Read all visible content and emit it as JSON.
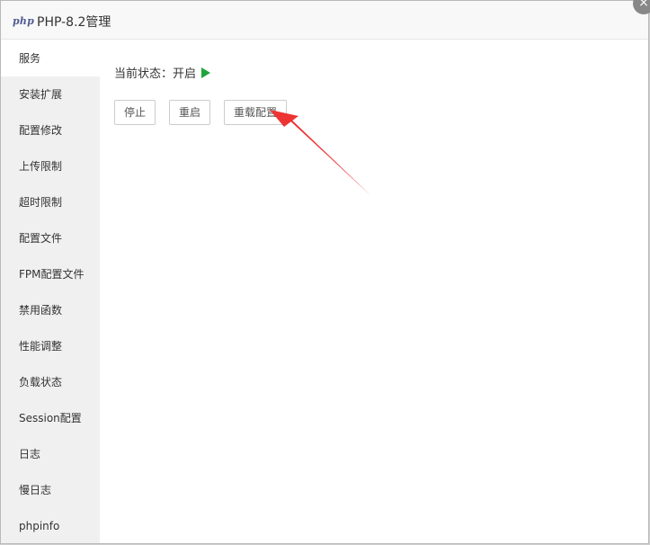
{
  "window": {
    "logo_text": "php",
    "title": "PHP-8.2管理",
    "close_symbol": "×"
  },
  "sidebar": {
    "items": [
      {
        "label": "服务",
        "active": true
      },
      {
        "label": "安装扩展"
      },
      {
        "label": "配置修改"
      },
      {
        "label": "上传限制"
      },
      {
        "label": "超时限制"
      },
      {
        "label": "配置文件"
      },
      {
        "label": "FPM配置文件"
      },
      {
        "label": "禁用函数"
      },
      {
        "label": "性能调整"
      },
      {
        "label": "负载状态"
      },
      {
        "label": "Session配置"
      },
      {
        "label": "日志"
      },
      {
        "label": "慢日志"
      },
      {
        "label": "phpinfo"
      }
    ]
  },
  "service": {
    "status_label": "当前状态：",
    "status_value": "开启",
    "status_icon": "play-icon",
    "status_color": "#20a53a",
    "buttons": {
      "stop": "停止",
      "restart": "重启",
      "reload": "重载配置"
    }
  },
  "annotation": {
    "arrow_color": "#ee3333"
  }
}
